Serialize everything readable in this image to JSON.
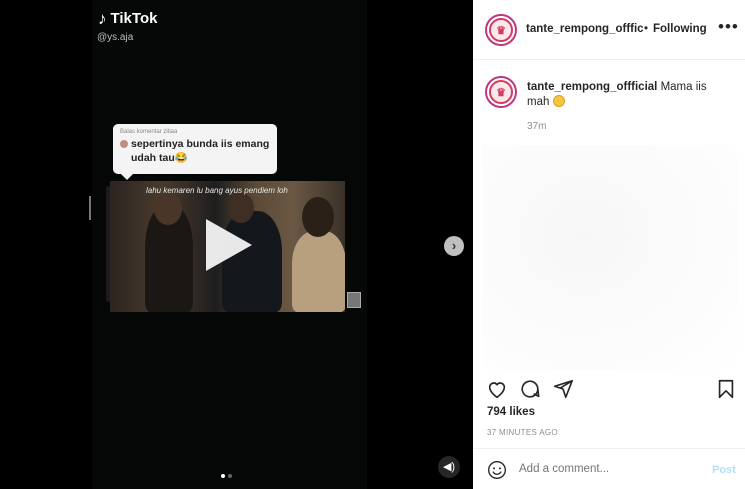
{
  "media": {
    "tiktok_label": "TikTok",
    "tiktok_handle": "@ys.aja",
    "reply_label": "Balas komentar zitiaa",
    "comment_text": "sepertinya bunda iis emang udah tau😂",
    "video_caption": "lahu kemaren lu bang ayus pendiem loh",
    "slide_count": 2,
    "active_slide": 0
  },
  "header": {
    "username": "tante_rempong_offficial",
    "separator": "•",
    "follow_label": "Following",
    "more_label": "•••"
  },
  "post": {
    "caption_user": "tante_rempong_offficial",
    "caption_text": "Mama iis mah",
    "time": "37m",
    "likes": "794 likes",
    "time_ago": "37 MINUTES AGO"
  },
  "comment_box": {
    "placeholder": "Add a comment...",
    "post_label": "Post"
  },
  "colors": {
    "post_button": "#b2dffc",
    "avatar_ring": "#c13584",
    "text_primary": "#262626",
    "text_secondary": "#8e8e8e"
  },
  "icons": [
    "tiktok-icon",
    "play-icon",
    "chevron-right-icon",
    "volume-icon",
    "more-icon",
    "heart-icon",
    "comment-icon",
    "share-icon",
    "bookmark-icon",
    "smile-icon"
  ]
}
